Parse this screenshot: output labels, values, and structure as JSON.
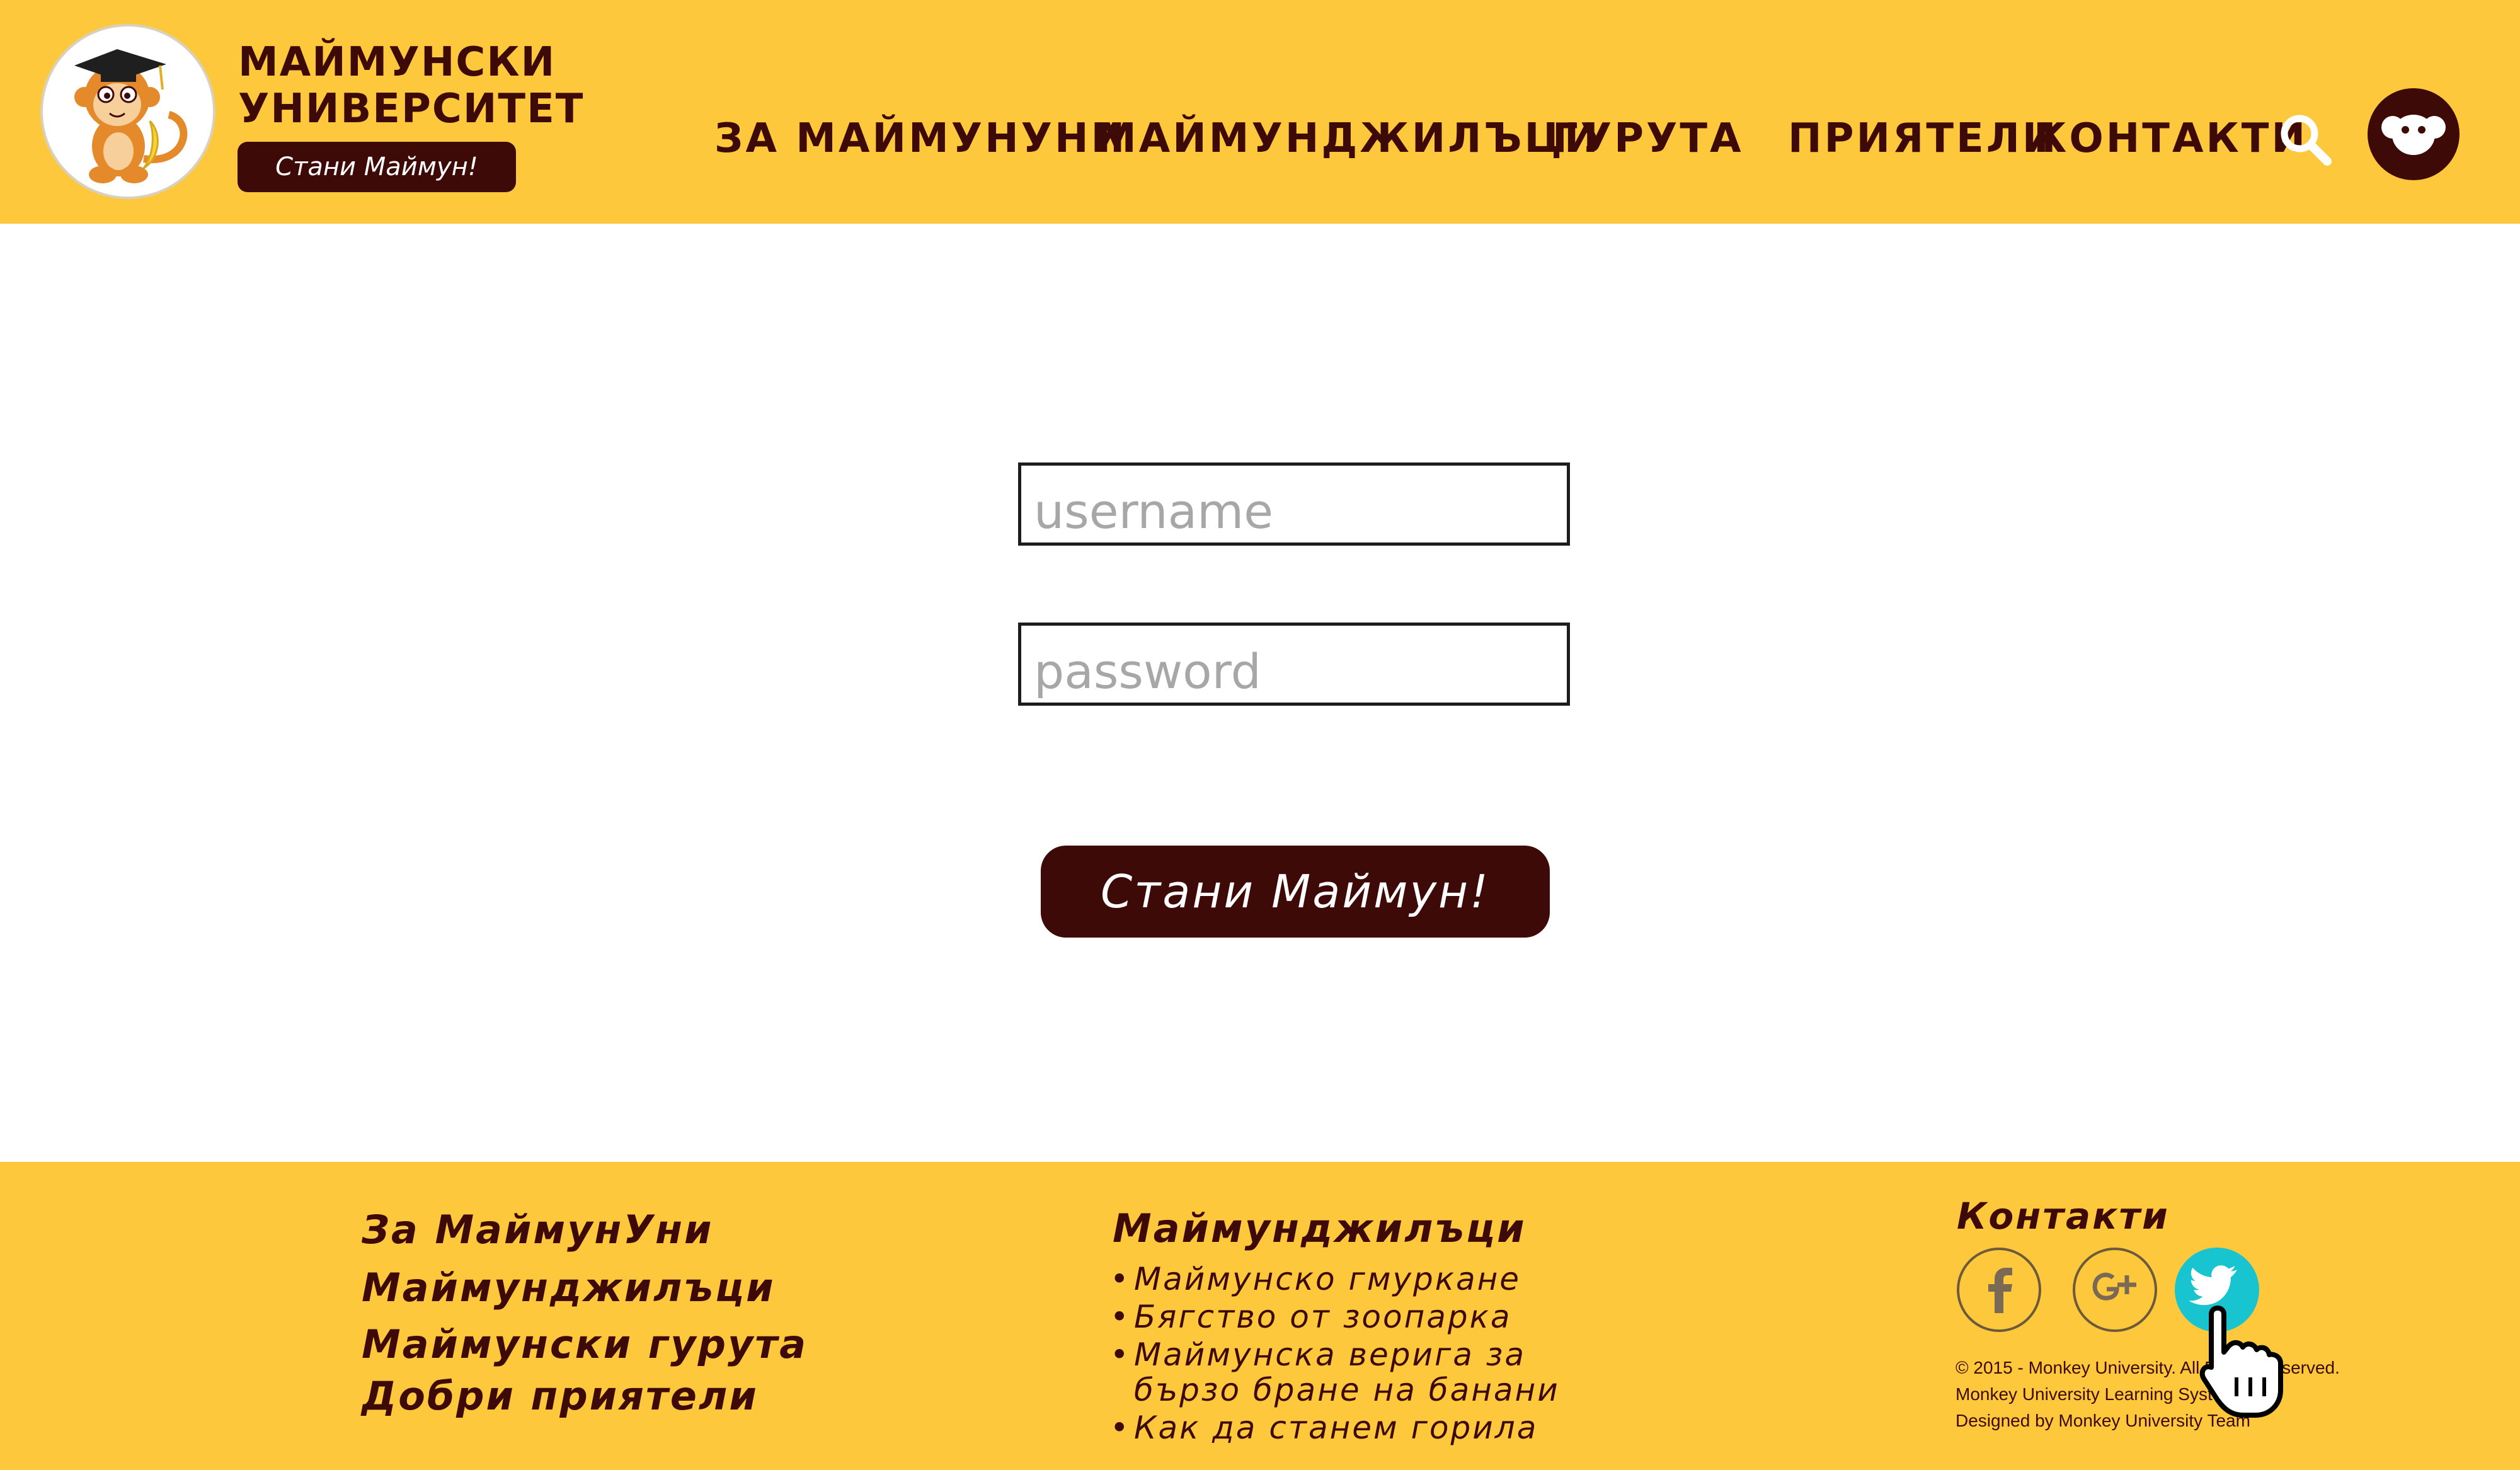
{
  "brand": {
    "title_line1": "МАЙМУНСКИ",
    "title_line2": "УНИВЕРСИТЕТ",
    "cta_label": "Стани Маймун!"
  },
  "nav": {
    "items": [
      {
        "label": "ЗА МАЙМУНУНИ"
      },
      {
        "label": "МАЙМУНДЖИЛЪЦИ"
      },
      {
        "label": "ГУРУТА"
      },
      {
        "label": "ПРИЯТЕЛИ"
      },
      {
        "label": "КОНТАКТИ"
      }
    ],
    "search_icon": "search-icon",
    "avatar_icon": "monkey-face-icon"
  },
  "login": {
    "username_placeholder": "username",
    "password_placeholder": "password",
    "submit_label": "Стани Маймун!"
  },
  "footer": {
    "links": [
      {
        "label": "За МаймунУни"
      },
      {
        "label": "Маймунджилъци"
      },
      {
        "label": "Маймунски гурута"
      },
      {
        "label": "Добри приятели"
      }
    ],
    "column_title": "Маймунджилъци",
    "bullets": [
      {
        "label": "Маймунско гмуркане"
      },
      {
        "label": "Бягство от зоопарка"
      },
      {
        "label": "Маймунска верига за бързо бране на банани"
      },
      {
        "label": "Как да станем горила"
      }
    ],
    "contacts_title": "Контакти",
    "social": [
      {
        "icon": "facebook-icon"
      },
      {
        "icon": "google-plus-icon"
      },
      {
        "icon": "twitter-icon"
      }
    ],
    "legal_line1": "© 2015 - Monkey University. All Rights Reserved.",
    "legal_line2": "Monkey University Learning System",
    "legal_line3": "Designed by Monkey University Team"
  },
  "colors": {
    "brand_yellow": "#fdc83c",
    "brand_brown": "#3d0a07",
    "twitter_teal": "#18c4cf"
  }
}
